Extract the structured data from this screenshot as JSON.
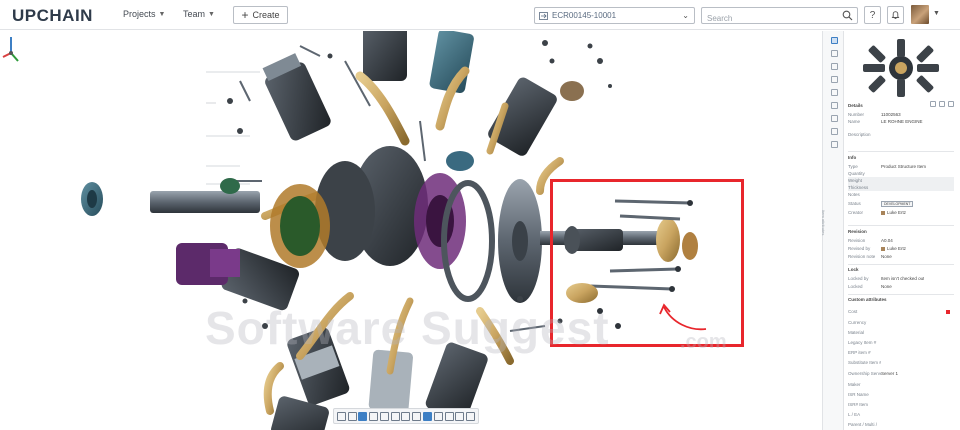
{
  "app": {
    "logo": "UPCHAIN"
  },
  "nav": {
    "projects": "Projects",
    "team": "Team",
    "create": "Create"
  },
  "topbar": {
    "ecr_value": "ECR00145-10001",
    "search_placeholder": "Search",
    "help_label": "?"
  },
  "watermark": {
    "main": "Software Suggest",
    "suffix": ".com"
  },
  "panel": {
    "details": {
      "title": "Details",
      "rows": [
        {
          "label": "Number",
          "value": "11002563"
        },
        {
          "label": "Name",
          "value": "LE ROHNE ENGINE"
        },
        {
          "label": "Description",
          "value": ""
        }
      ]
    },
    "info": {
      "title": "Info",
      "rows": [
        {
          "label": "Type",
          "value": "Product Structure Item"
        },
        {
          "label": "Quantity",
          "value": ""
        },
        {
          "label": "Weight",
          "value": ""
        },
        {
          "label": "Thickness",
          "value": ""
        },
        {
          "label": "Notes",
          "value": ""
        },
        {
          "label": "Status",
          "value": "DEVELOPMENT"
        },
        {
          "label": "Creator",
          "value": "Luke Ertz"
        }
      ]
    },
    "revision": {
      "title": "Revision",
      "rows": [
        {
          "label": "Revision",
          "value": "A0.04"
        },
        {
          "label": "Revised by",
          "value": "Luke Ertz"
        },
        {
          "label": "Revision note",
          "value": "None"
        }
      ]
    },
    "lock": {
      "title": "Lock",
      "rows": [
        {
          "label": "Locked by",
          "value": "Item isn't checked out"
        },
        {
          "label": "Locked",
          "value": "None"
        }
      ]
    },
    "custom": {
      "title": "Custom attributes",
      "rows": [
        {
          "label": "Cost",
          "value": ""
        },
        {
          "label": "Currency",
          "value": ""
        },
        {
          "label": "Material",
          "value": ""
        },
        {
          "label": "Legacy Item #",
          "value": ""
        },
        {
          "label": "ERP item #",
          "value": ""
        },
        {
          "label": "Substitute Item #",
          "value": ""
        },
        {
          "label": "Ownership Server",
          "value": "Server 1"
        },
        {
          "label": "Maker",
          "value": ""
        },
        {
          "label": "ISR Name",
          "value": ""
        },
        {
          "label": "ISR# Item",
          "value": ""
        },
        {
          "label": "L / EA",
          "value": ""
        },
        {
          "label": "Parent / Multi /",
          "value": ""
        }
      ]
    },
    "side_label": "Item attributes"
  },
  "colors": {
    "accent": "#3d7fc4",
    "highlight": "#e8262c",
    "brass": "#c9a460",
    "steel": "#6f7a86"
  }
}
